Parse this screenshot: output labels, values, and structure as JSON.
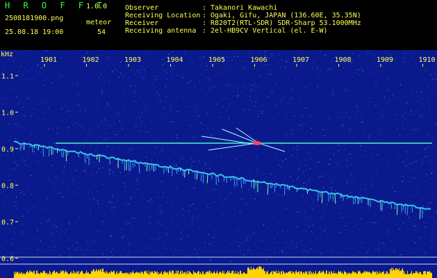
{
  "header": {
    "app_name": "H R O F F T",
    "version": "1.0.0",
    "filename": "2508181900.png",
    "meteor_label": "meteor",
    "datetime": "25.08.18 19:00",
    "meteor_count": "54",
    "info": [
      {
        "label": "Observer",
        "value": "Takanori Kawachi"
      },
      {
        "label": "Receiving Location",
        "value": "Ogaki, Gifu, JAPAN (136.60E, 35.35N)"
      },
      {
        "label": "Receiver",
        "value": "R820T2(RTL-SDR) SDR-Sharp 53.1000MHz"
      },
      {
        "label": "Receiving antenna",
        "value": "2el-HB9CV Vertical (el. E-W)"
      }
    ],
    "separator": ":"
  },
  "spectrogram": {
    "y_unit": "kHz",
    "x_ticks": [
      "1901",
      "1902",
      "1903",
      "1904",
      "1905",
      "1906",
      "1907",
      "1908",
      "1909",
      "1910"
    ],
    "y_ticks": [
      "1.1",
      "1.0",
      "0.9",
      "0.8",
      "0.7",
      "0.6"
    ],
    "y_range": [
      0.58,
      1.17
    ],
    "carrier_khz": 0.915,
    "background_color": "#0a1a8c",
    "axis_color": "#ffff55",
    "signal_color": "#40e0ff"
  }
}
